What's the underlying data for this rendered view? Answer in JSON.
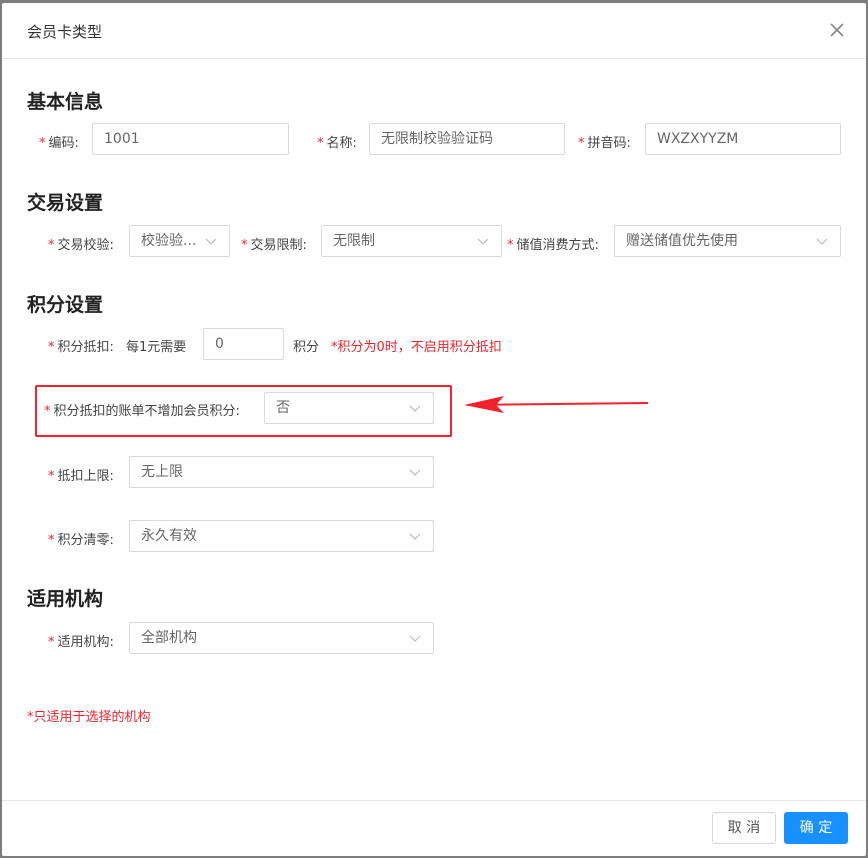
{
  "dialog": {
    "title": "会员卡类型"
  },
  "sections": {
    "basic": "基本信息",
    "trade": "交易设置",
    "points": "积分设置",
    "org": "适用机构"
  },
  "basic": {
    "code_label": "编码:",
    "code_value": "1001",
    "name_label": "名称:",
    "name_value": "无限制校验验证码",
    "pinyin_label": "拼音码:",
    "pinyin_value": "WXZXYYZM"
  },
  "trade": {
    "verify_label": "交易校验:",
    "verify_value": "校验验...",
    "limit_label": "交易限制:",
    "limit_value": "无限制",
    "stored_label": "储值消费方式:",
    "stored_value": "赠送储值优先使用"
  },
  "points": {
    "deduct_label": "积分抵扣:",
    "deduct_prefix": "每1元需要",
    "deduct_value": "0",
    "deduct_unit": "积分",
    "deduct_hint": "*积分为0时，不启用积分抵扣",
    "no_add_label": "积分抵扣的账单不增加会员积分:",
    "no_add_value": "否",
    "cap_label": "抵扣上限:",
    "cap_value": "无上限",
    "clear_label": "积分清零:",
    "clear_value": "永久有效"
  },
  "org": {
    "label": "适用机构:",
    "value": "全部机构",
    "hint": "*只适用于选择的机构"
  },
  "required_mark": "*",
  "footer": {
    "cancel_label": "取 消",
    "ok_label": "确 定"
  },
  "colors": {
    "accent": "#1890ff",
    "required": "#f5222d",
    "annotation": "#f5222d"
  },
  "icons": {
    "close": "close-icon",
    "chevron": "chevron-down-icon",
    "arrow": "arrow-left-icon"
  }
}
